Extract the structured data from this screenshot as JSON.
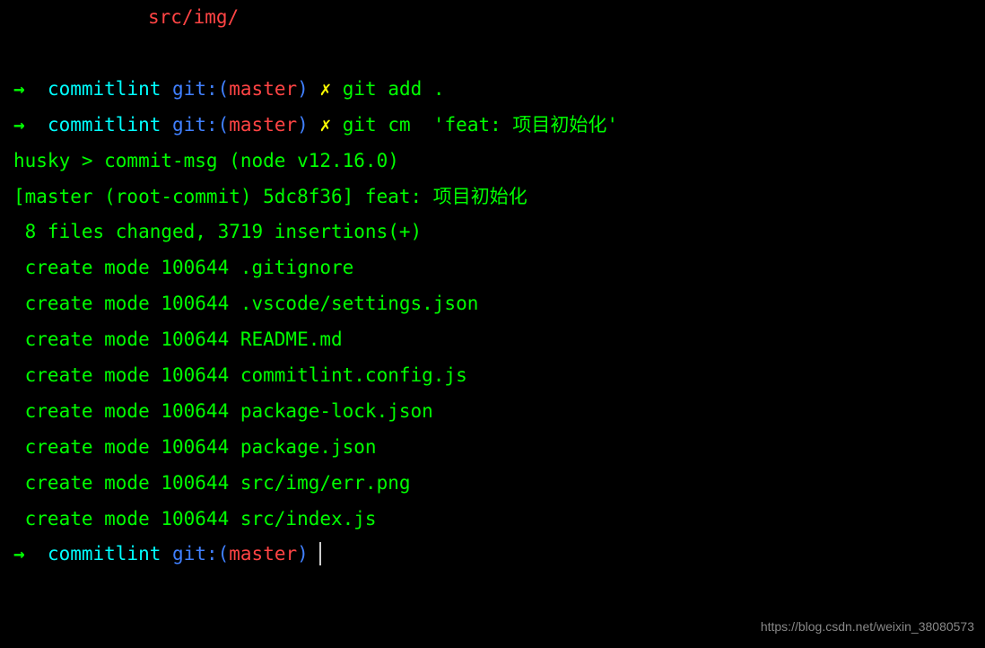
{
  "top_line": "src/img/",
  "prompt1": {
    "arrow": "→",
    "folder": "commitlint",
    "git_prefix": "git:(",
    "branch": "master",
    "git_suffix": ")",
    "dirty": "✗",
    "command": "git add ."
  },
  "prompt2": {
    "arrow": "→",
    "folder": "commitlint",
    "git_prefix": "git:(",
    "branch": "master",
    "git_suffix": ")",
    "dirty": "✗",
    "command": "git cm  'feat: 项目初始化'"
  },
  "output": {
    "husky": "husky > commit-msg (node v12.16.0)",
    "commit_header": "[master (root-commit) 5dc8f36] feat: 项目初始化",
    "summary": " 8 files changed, 3719 insertions(+)",
    "files": [
      " create mode 100644 .gitignore",
      " create mode 100644 .vscode/settings.json",
      " create mode 100644 README.md",
      " create mode 100644 commitlint.config.js",
      " create mode 100644 package-lock.json",
      " create mode 100644 package.json",
      " create mode 100644 src/img/err.png",
      " create mode 100644 src/index.js"
    ]
  },
  "prompt3": {
    "arrow": "→",
    "folder": "commitlint",
    "git_prefix": "git:(",
    "branch": "master",
    "git_suffix": ")"
  },
  "watermark": "https://blog.csdn.net/weixin_38080573"
}
